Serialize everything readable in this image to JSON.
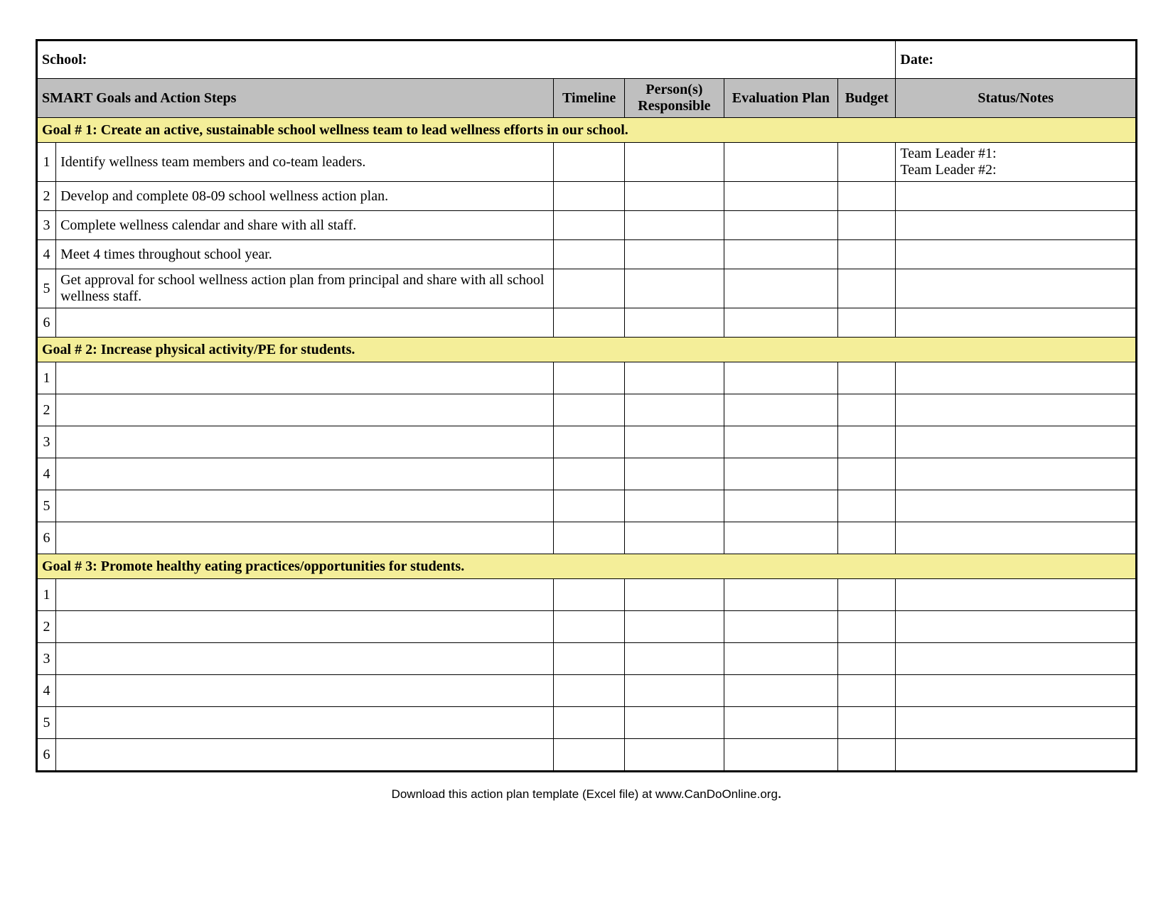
{
  "header": {
    "school_label": "School:",
    "date_label": "Date:"
  },
  "columns": {
    "c1": "SMART Goals and Action Steps",
    "c2": "Timeline",
    "c3": "Person(s) Responsible",
    "c4": "Evaluation Plan",
    "c5": "Budget",
    "c6": "Status/Notes"
  },
  "goals": [
    {
      "title": "Goal # 1: Create an active, sustainable school wellness team to lead wellness efforts in our school.",
      "steps": [
        {
          "n": "1",
          "desc": "Identify wellness team members and co-team leaders.",
          "tl": "",
          "pr": "",
          "ep": "",
          "bud": "",
          "status": "Team Leader #1:\nTeam Leader #2:"
        },
        {
          "n": "2",
          "desc": "Develop and complete 08-09 school wellness action plan.",
          "tl": "",
          "pr": "",
          "ep": "",
          "bud": "",
          "status": ""
        },
        {
          "n": "3",
          "desc": "Complete wellness calendar and share with all staff.",
          "tl": "",
          "pr": "",
          "ep": "",
          "bud": "",
          "status": ""
        },
        {
          "n": "4",
          "desc": "Meet 4 times throughout school year.",
          "tl": "",
          "pr": "",
          "ep": "",
          "bud": "",
          "status": ""
        },
        {
          "n": "5",
          "desc": "Get approval for school wellness action plan from principal and share with all school wellness staff.",
          "tl": "",
          "pr": "",
          "ep": "",
          "bud": "",
          "status": ""
        },
        {
          "n": "6",
          "desc": "",
          "tl": "",
          "pr": "",
          "ep": "",
          "bud": "",
          "status": ""
        }
      ]
    },
    {
      "title": "Goal # 2: Increase physical activity/PE for students.",
      "steps": [
        {
          "n": "1",
          "desc": "",
          "tl": "",
          "pr": "",
          "ep": "",
          "bud": "",
          "status": ""
        },
        {
          "n": "2",
          "desc": "",
          "tl": "",
          "pr": "",
          "ep": "",
          "bud": "",
          "status": ""
        },
        {
          "n": "3",
          "desc": "",
          "tl": "",
          "pr": "",
          "ep": "",
          "bud": "",
          "status": ""
        },
        {
          "n": "4",
          "desc": "",
          "tl": "",
          "pr": "",
          "ep": "",
          "bud": "",
          "status": ""
        },
        {
          "n": "5",
          "desc": "",
          "tl": "",
          "pr": "",
          "ep": "",
          "bud": "",
          "status": ""
        },
        {
          "n": "6",
          "desc": "",
          "tl": "",
          "pr": "",
          "ep": "",
          "bud": "",
          "status": ""
        }
      ]
    },
    {
      "title": "Goal # 3: Promote healthy eating practices/opportunities for students.",
      "steps": [
        {
          "n": "1",
          "desc": "",
          "tl": "",
          "pr": "",
          "ep": "",
          "bud": "",
          "status": ""
        },
        {
          "n": "2",
          "desc": "",
          "tl": "",
          "pr": "",
          "ep": "",
          "bud": "",
          "status": ""
        },
        {
          "n": "3",
          "desc": "",
          "tl": "",
          "pr": "",
          "ep": "",
          "bud": "",
          "status": ""
        },
        {
          "n": "4",
          "desc": "",
          "tl": "",
          "pr": "",
          "ep": "",
          "bud": "",
          "status": ""
        },
        {
          "n": "5",
          "desc": "",
          "tl": "",
          "pr": "",
          "ep": "",
          "bud": "",
          "status": ""
        },
        {
          "n": "6",
          "desc": "",
          "tl": "",
          "pr": "",
          "ep": "",
          "bud": "",
          "status": ""
        }
      ]
    }
  ],
  "footer": "Download this action plan template (Excel file) at www.CanDoOnline.org"
}
